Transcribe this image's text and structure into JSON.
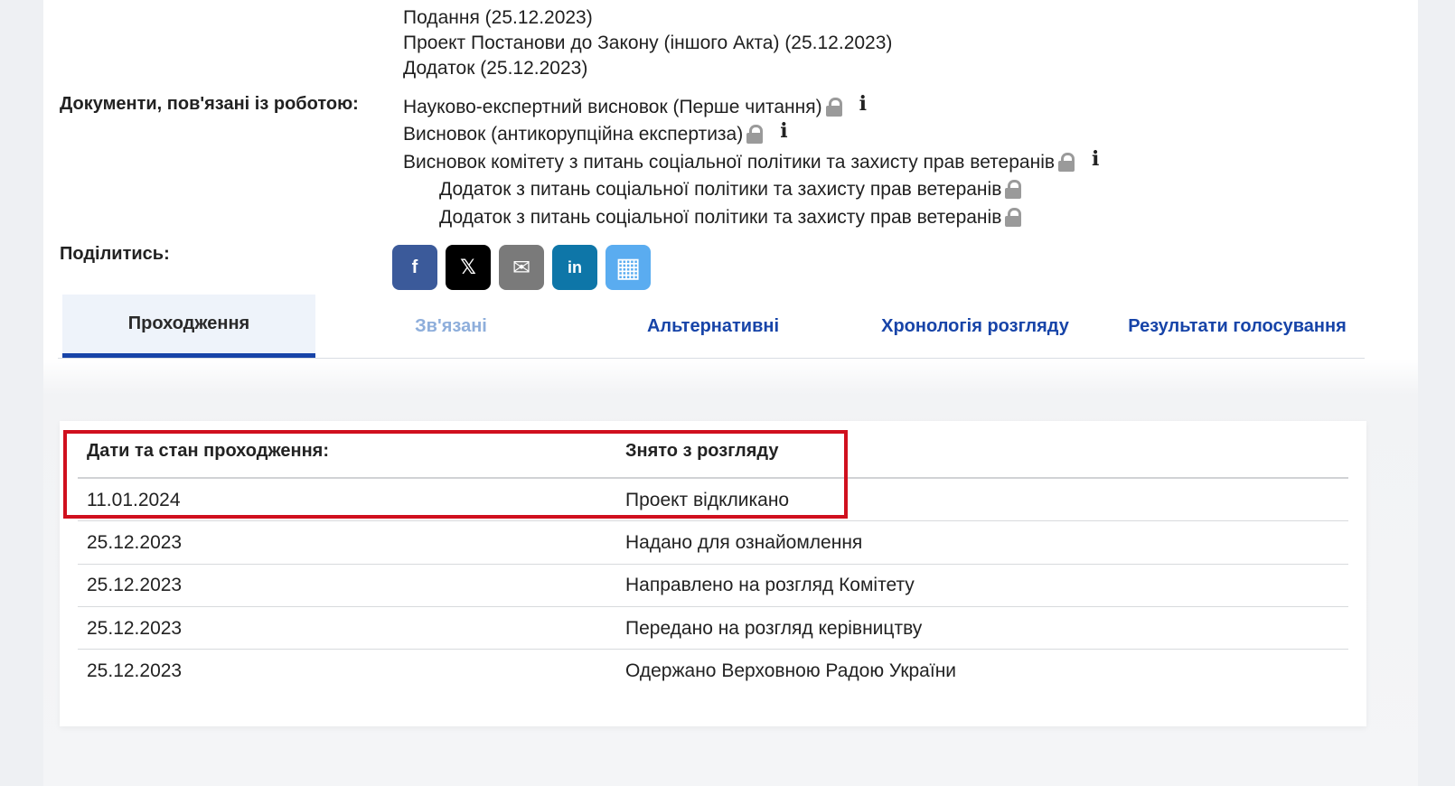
{
  "documents_top": [
    "Подання (25.12.2023)",
    "Проект Постанови до Закону (іншого Акта) (25.12.2023)",
    "Додаток (25.12.2023)"
  ],
  "related_docs_label": "Документи, пов'язані із роботою:",
  "related_docs": [
    {
      "text": "Науково-експертний висновок (Перше читання)",
      "locked": true,
      "info": true
    },
    {
      "text": "Висновок (антикорупційна експертиза)",
      "locked": true,
      "info": true
    },
    {
      "text": "Висновок комітету з питань соціальної політики та захисту прав ветеранів",
      "locked": true,
      "info": true
    },
    {
      "text": "Додаток з питань соціальної політики та захисту прав ветеранів",
      "locked": true,
      "info": false
    },
    {
      "text": "Додаток з питань соціальної політики та захисту прав ветеранів",
      "locked": true,
      "info": false
    }
  ],
  "share_label": "Поділитись:",
  "share_buttons": [
    {
      "name": "facebook",
      "glyph": "f",
      "color": "#3b5a9a"
    },
    {
      "name": "x",
      "glyph": "𝕏",
      "color": "#000000"
    },
    {
      "name": "email",
      "glyph": "✉",
      "color": "#7a7a7a"
    },
    {
      "name": "linkedin",
      "glyph": "in",
      "color": "#0e76a8"
    },
    {
      "name": "qr",
      "glyph": "▦",
      "color": "#5aacf0"
    }
  ],
  "tabs": [
    {
      "label": "Проходження",
      "state": "active"
    },
    {
      "label": "Зв'язані",
      "state": "muted"
    },
    {
      "label": "Альтернативні",
      "state": "normal"
    },
    {
      "label": "Хронологія розгляду",
      "state": "normal"
    },
    {
      "label": "Результати голосування",
      "state": "normal"
    }
  ],
  "table": {
    "header_left": "Дати та стан проходження:",
    "header_right": "Знято з розгляду",
    "rows": [
      {
        "date": "11.01.2024",
        "status": "Проект відкликано"
      },
      {
        "date": "25.12.2023",
        "status": "Надано для ознайомлення"
      },
      {
        "date": "25.12.2023",
        "status": "Направлено на розгляд Комітету"
      },
      {
        "date": "25.12.2023",
        "status": "Передано на розгляд керівництву"
      },
      {
        "date": "25.12.2023",
        "status": "Одержано Верховною Радою України"
      }
    ]
  },
  "colors": {
    "accent": "#1744a8",
    "highlight": "#d0101e"
  }
}
